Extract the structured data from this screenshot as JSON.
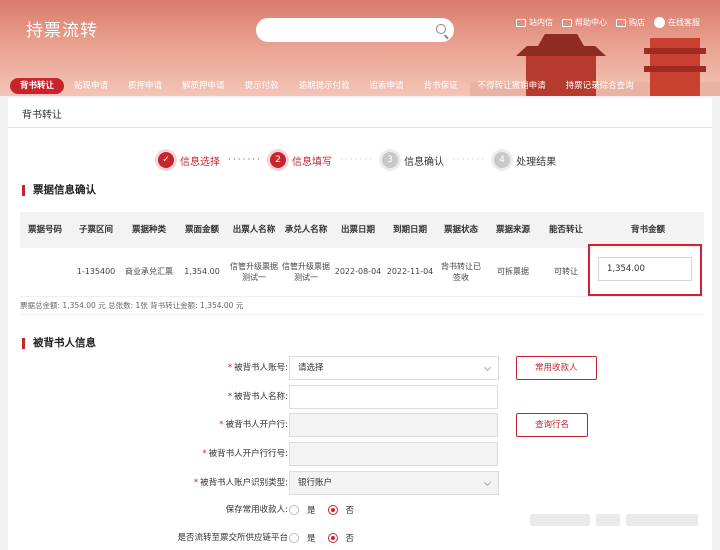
{
  "header": {
    "brand": "持票流转",
    "tools": [
      "站内信",
      "帮助中心",
      "购店",
      "在线客服"
    ]
  },
  "nav": [
    "背书转让",
    "贴现申请",
    "质押申请",
    "解质押申请",
    "提示付款",
    "逾期提示付款",
    "追索申请",
    "背书保证",
    "不得转让撤销申请",
    "持票记录综合查询"
  ],
  "page": {
    "breadcrumb": "背书转让"
  },
  "steps": [
    {
      "num": "✓",
      "label": "信息选择",
      "state": "done"
    },
    {
      "num": "2",
      "label": "信息填写",
      "state": "current"
    },
    {
      "num": "3",
      "label": "信息确认",
      "state": "todo"
    },
    {
      "num": "4",
      "label": "处理结果",
      "state": "todo"
    }
  ],
  "bill_section": {
    "title": "票据信息确认",
    "columns": [
      "票据号码",
      "子票区间",
      "票据种类",
      "票面金额",
      "出票人名称",
      "承兑人名称",
      "出票日期",
      "到期日期",
      "票据状态",
      "票据来源",
      "能否转让",
      "背书金额"
    ],
    "row": [
      "",
      "1-135400",
      "商业承兑汇票",
      "1,354.00",
      "信管升级票据测试一",
      "信管升级票据测试一",
      "2022-08-04",
      "2022-11-04",
      "背书转让已签收",
      "可拆票据",
      "可转让"
    ],
    "endorse_amount": "1,354.00",
    "summary": "票据总金额: 1,354.00 元 总张数: 1张 背书转让金额: 1,354.00 元"
  },
  "endorsee_section": {
    "title": "被背书人信息",
    "fields": {
      "account_label": "被背书人账号:",
      "account_value": "请选择",
      "name_label": "被背书人名称:",
      "bank_label": "被背书人开户行:",
      "bank_no_label": "被背书人开户行行号:",
      "acct_type_label": "被背书人账户识别类型:",
      "acct_type_value": "银行账户",
      "save_label": "保存常用收款人:",
      "platform_label": "是否流转至票交所供应链平台"
    },
    "buttons": {
      "common_payee": "常用收款人",
      "query_bank": "查询行名"
    },
    "radio": {
      "yes": "是",
      "no": "否"
    }
  },
  "colors": {
    "accent": "#c9242e"
  }
}
